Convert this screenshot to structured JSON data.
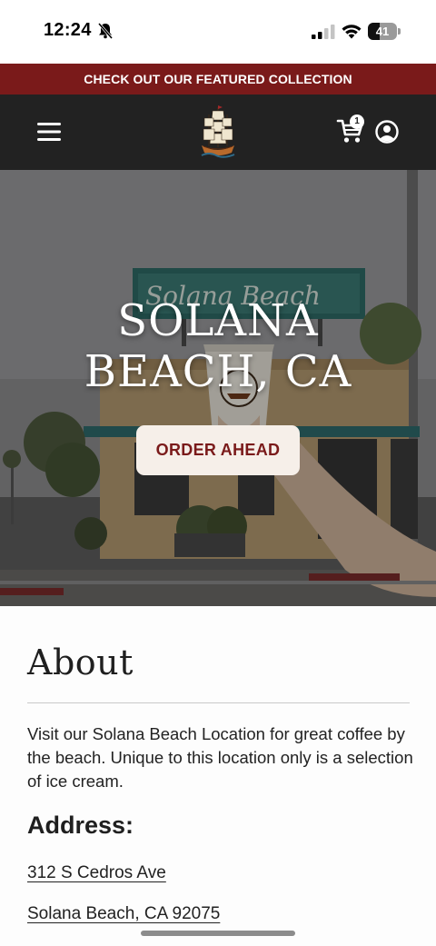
{
  "status_bar": {
    "time": "12:24",
    "battery_level": 41,
    "battery_label": "41",
    "icons": [
      "bell-muted-icon",
      "signal-icon",
      "wifi-icon",
      "battery-icon"
    ]
  },
  "promo": {
    "text": "CHECK OUT OUR FEATURED COLLECTION"
  },
  "header": {
    "menu_icon": "hamburger-menu-icon",
    "logo_icon": "ship-logo-icon",
    "cart_icon": "cart-icon",
    "cart_count": "1",
    "account_icon": "account-icon"
  },
  "hero": {
    "title_line1": "SOLANA",
    "title_line2": "BEACH, CA",
    "cta_label": "ORDER AHEAD",
    "sign_text": "Solana Beach"
  },
  "about": {
    "heading": "About",
    "body": "Visit our Solana Beach Location for great coffee by the beach. Unique to this location only is a selection of ice cream.",
    "address_heading": "Address:",
    "address_line1": "312 S Cedros Ave",
    "address_line2": "Solana Beach, CA 92075"
  },
  "colors": {
    "promo_bg": "#7a1a1a",
    "header_bg": "#222222",
    "cta_bg": "#f6efe9",
    "cta_text": "#7a1a1a"
  }
}
